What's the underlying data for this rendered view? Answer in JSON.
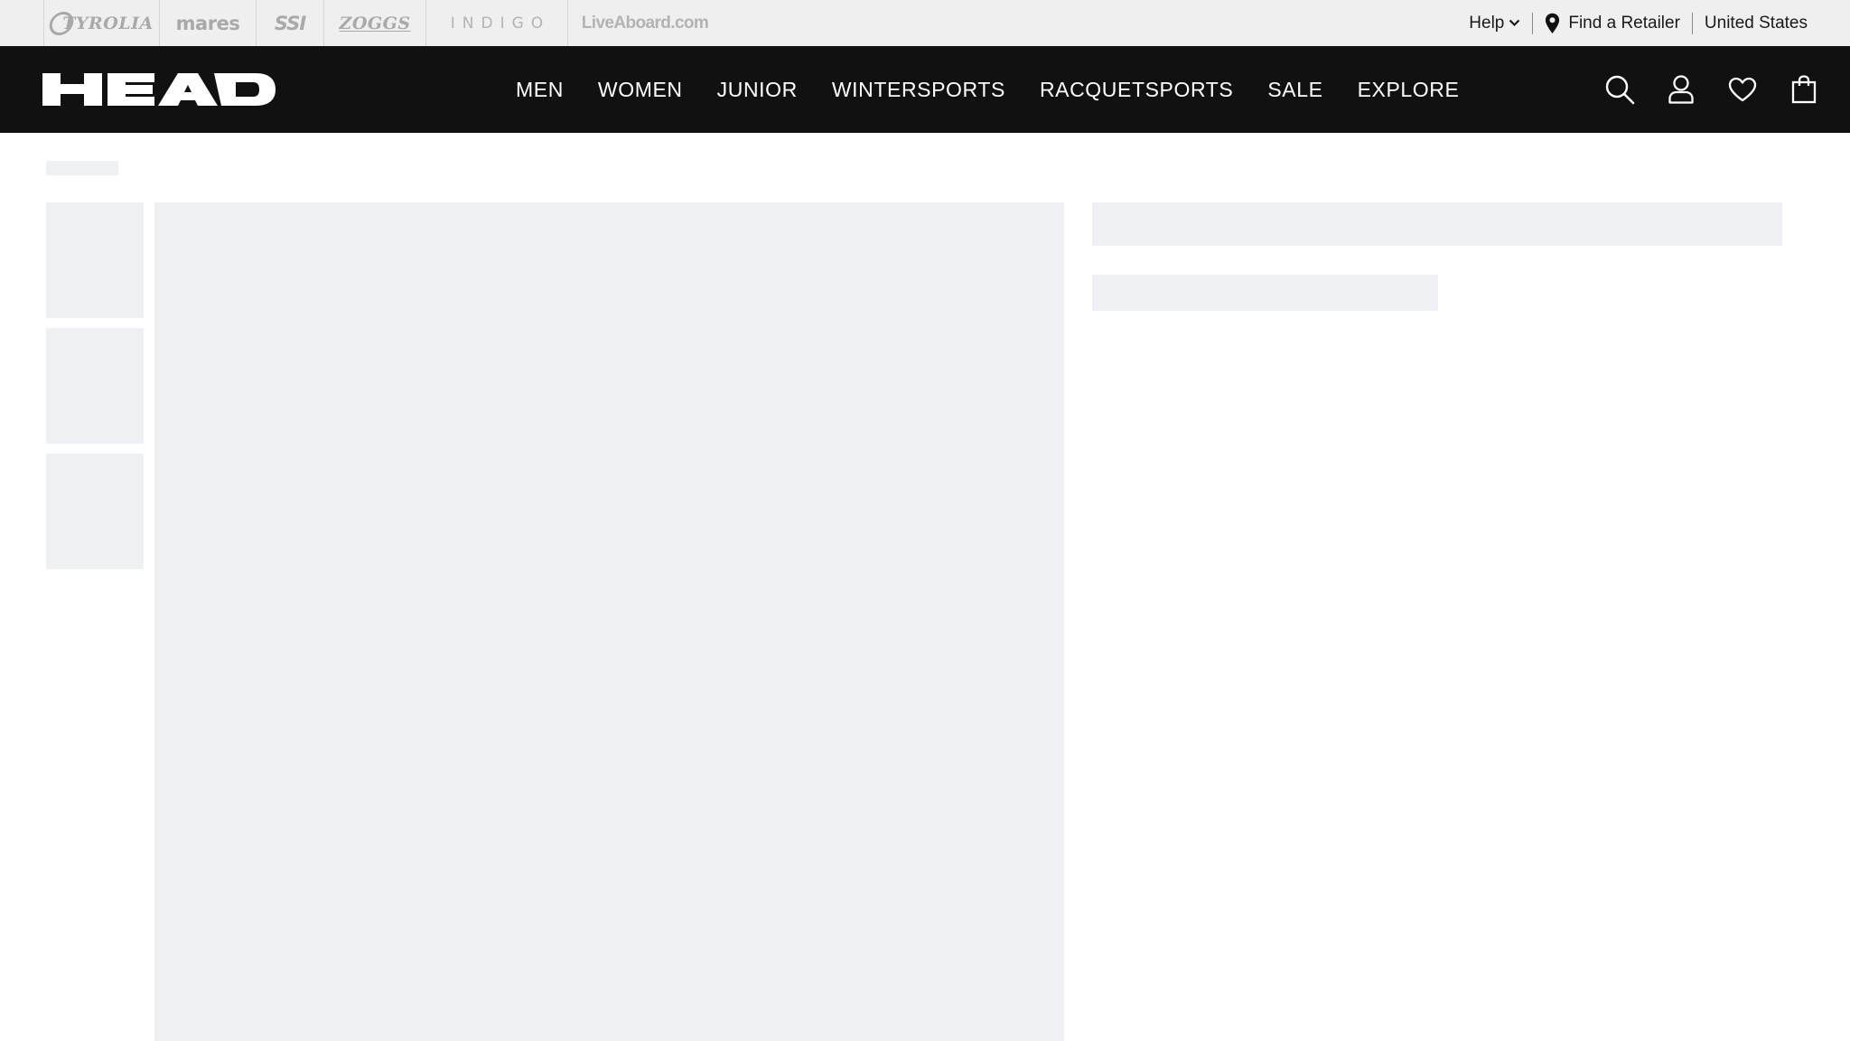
{
  "brand_bar": {
    "brands": [
      {
        "name": "Tyrolia",
        "display": "TYROLIA"
      },
      {
        "name": "Mares",
        "display": "mares"
      },
      {
        "name": "SSI",
        "display": "SSI"
      },
      {
        "name": "Zoggs",
        "display": "ZOGGS"
      },
      {
        "name": "Indigo",
        "display": "INDIGO"
      },
      {
        "name": "LiveAboard",
        "display": "LiveAboard.com"
      }
    ],
    "help_label": "Help",
    "find_retailer_label": "Find a Retailer",
    "country_label": "United States"
  },
  "header": {
    "logo_text": "HEAD",
    "nav": [
      "MEN",
      "WOMEN",
      "JUNIOR",
      "WINTERSPORTS",
      "RACQUETSPORTS",
      "SALE",
      "EXPLORE"
    ],
    "icons": [
      "search-icon",
      "account-icon",
      "wishlist-heart-icon",
      "shopping-bag-icon"
    ]
  },
  "colors": {
    "brand_bar_bg": "#efefef",
    "header_bg": "#111111",
    "skeleton": "#eff0f4",
    "brand_logo_gray": "#a9a9a9"
  }
}
